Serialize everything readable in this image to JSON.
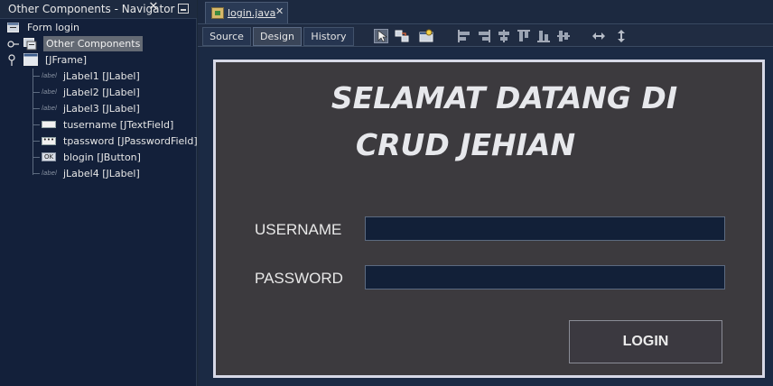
{
  "navigator": {
    "title": "Other Components - Navigator",
    "close_glyph": "✕",
    "tree": {
      "root": "Form login",
      "other_components": "Other Components",
      "frame": "[JFrame]",
      "children": [
        {
          "label": "jLabel1 [JLabel]",
          "icon": "label-icon",
          "icon_text": "label"
        },
        {
          "label": "jLabel2 [JLabel]",
          "icon": "label-icon",
          "icon_text": "label"
        },
        {
          "label": "jLabel3 [JLabel]",
          "icon": "label-icon",
          "icon_text": "label"
        },
        {
          "label": "tusername [JTextField]",
          "icon": "textfield-icon",
          "icon_text": ""
        },
        {
          "label": "tpassword [JPasswordField]",
          "icon": "passwordfield-icon",
          "icon_text": "•••"
        },
        {
          "label": "blogin [JButton]",
          "icon": "button-icon",
          "icon_text": "OK"
        },
        {
          "label": "jLabel4 [JLabel]",
          "icon": "label-icon",
          "icon_text": "label"
        }
      ]
    }
  },
  "editor": {
    "file_tab": {
      "label": "login.java",
      "close_glyph": "✕"
    },
    "toolbar": {
      "source": "Source",
      "design": "Design",
      "history": "History"
    }
  },
  "form": {
    "title_line1": "SELAMAT DATANG DI",
    "title_line2": "CRUD JEHIAN",
    "username_label": "USERNAME",
    "username_value": "",
    "password_label": "PASSWORD",
    "password_value": "",
    "login_button": "LOGIN"
  },
  "colors": {
    "form_background": "#3c3a3e",
    "form_border": "#d6d8e6",
    "input_background": "#122038",
    "panel_background": "#13203a"
  }
}
